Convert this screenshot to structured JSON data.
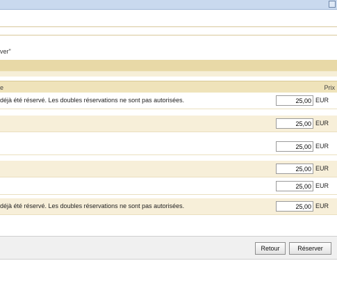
{
  "caption": "ver\"",
  "table": {
    "col1_header": "e",
    "col2_header": "Prix",
    "rows": [
      {
        "message": "déjà été réservé. Les doubles réservations ne sont pas autorisées.",
        "price": "25,00",
        "currency": "EUR"
      },
      {
        "message": "",
        "price": "25,00",
        "currency": "EUR"
      },
      {
        "message": "",
        "price": "25,00",
        "currency": "EUR"
      },
      {
        "message": "",
        "price": "25,00",
        "currency": "EUR"
      },
      {
        "message": "",
        "price": "25,00",
        "currency": "EUR"
      },
      {
        "message": "déjà été réservé. Les doubles réservations ne sont pas autorisées.",
        "price": "25,00",
        "currency": "EUR"
      }
    ]
  },
  "buttons": {
    "back": "Retour",
    "reserve": "Réserver"
  }
}
